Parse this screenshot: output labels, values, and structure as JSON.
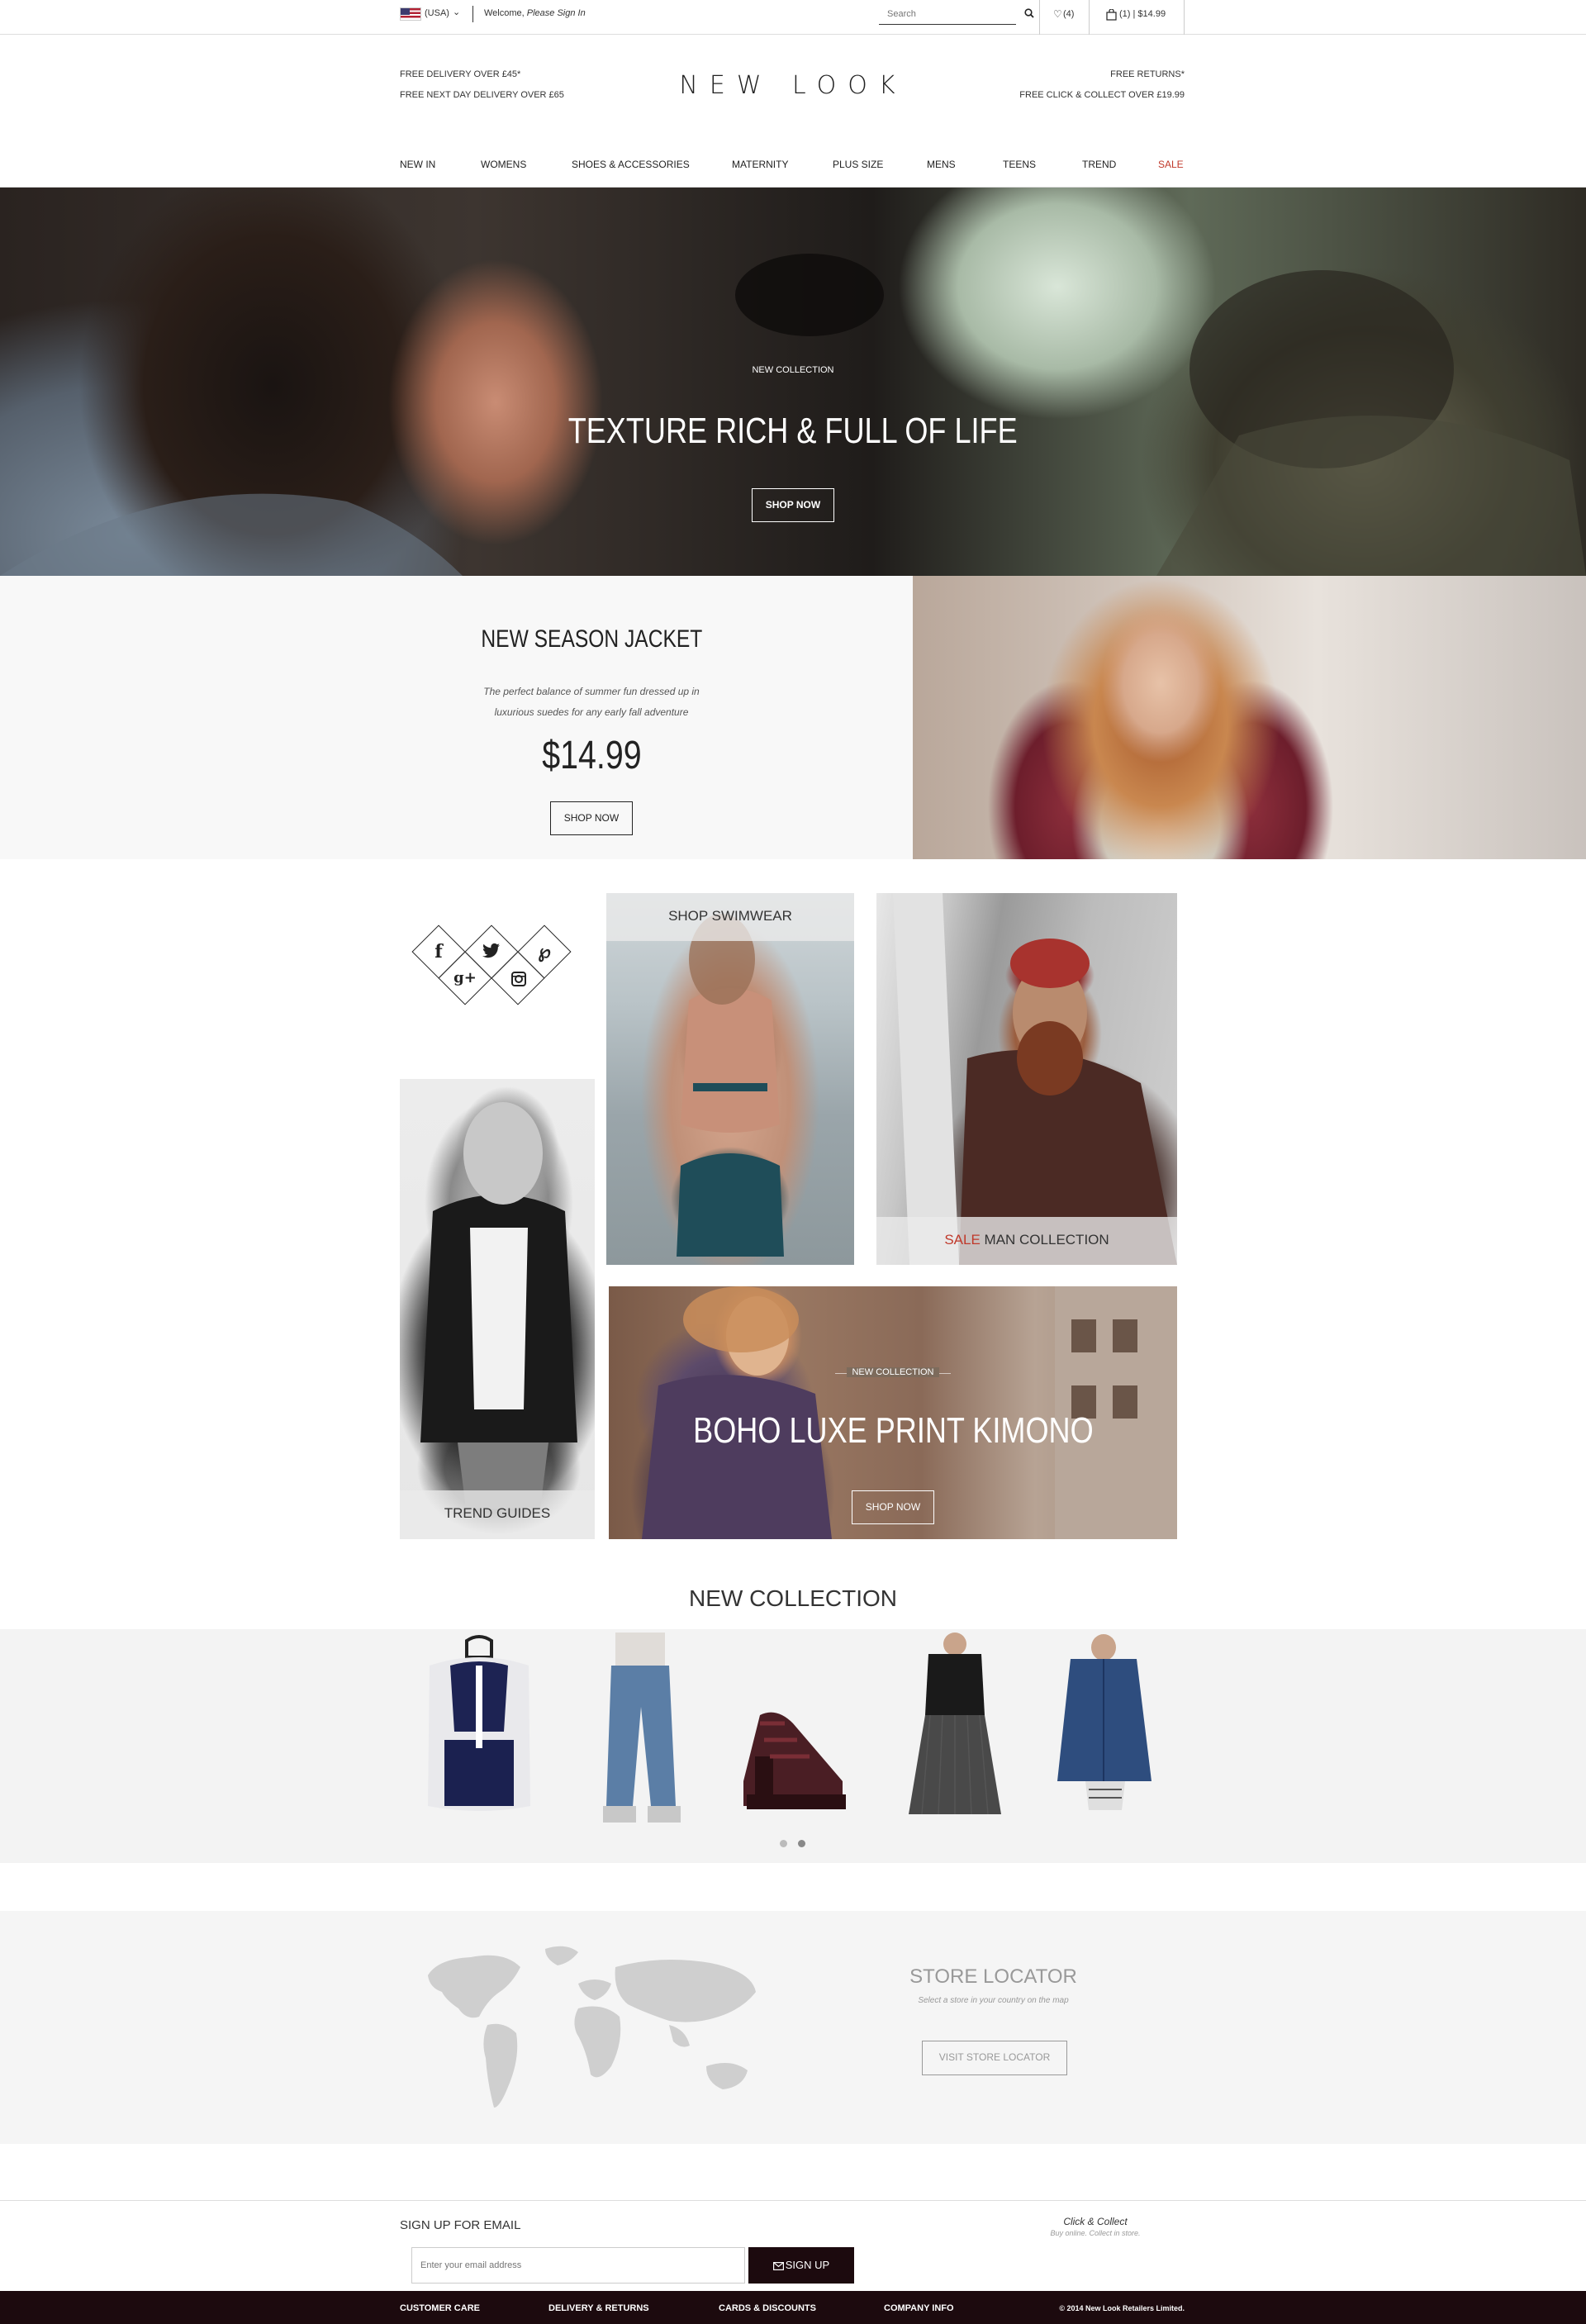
{
  "topbar": {
    "country": "(USA)",
    "welcome_prefix": "Welcome,",
    "welcome_link": "Please Sign In",
    "search_placeholder": "Search",
    "wishlist": "(4)",
    "cart": "(1) | $14.99"
  },
  "header": {
    "left_line1": "FREE DELIVERY OVER £45*",
    "left_line2": "FREE NEXT DAY DELIVERY OVER £65",
    "logo": "NEW LOOK",
    "right_line1": "FREE RETURNS*",
    "right_line2": "FREE CLICK & COLLECT OVER £19.99"
  },
  "nav": [
    {
      "label": "NEW IN"
    },
    {
      "label": "WOMENS"
    },
    {
      "label": "SHOES & ACCESSORIES"
    },
    {
      "label": "MATERNITY"
    },
    {
      "label": "PLUS SIZE"
    },
    {
      "label": "MENS"
    },
    {
      "label": "TEENS"
    },
    {
      "label": "TREND"
    },
    {
      "label": "SALE"
    }
  ],
  "hero": {
    "kicker": "NEW COLLECTION",
    "title": "TEXTURE RICH & FULL OF LIFE",
    "button": "SHOP NOW"
  },
  "jacket": {
    "title": "NEW SEASON JACKET",
    "desc_line1": "The perfect balance of summer fun dressed up in",
    "desc_line2": "luxurious suedes for any early fall adventure",
    "price": "$14.99",
    "button": "SHOP NOW"
  },
  "tiles": {
    "swimwear": "SHOP SWIMWEAR",
    "man_sale": "SALE",
    "man_label": "MAN COLLECTION",
    "trend": "TREND GUIDES",
    "kimono_kicker": "NEW COLLECTION",
    "kimono_title": "BOHO LUXE PRINT KIMONO",
    "kimono_button": "SHOP NOW"
  },
  "new_collection": {
    "title": "NEW COLLECTION",
    "products": [
      "backpack",
      "jeans",
      "heels",
      "pleated-dress",
      "denim-parka"
    ],
    "active_dot": 1
  },
  "store_locator": {
    "title": "STORE LOCATOR",
    "subtitle": "Select a store in your country on the map",
    "button": "VISIT STORE LOCATOR"
  },
  "signup": {
    "title": "SIGN UP FOR EMAIL",
    "placeholder": "Enter your email address",
    "button": "SIGN UP",
    "cc_title": "Click & Collect",
    "cc_sub": "Buy online. Collect in store."
  },
  "footer": {
    "links": [
      "CUSTOMER CARE",
      "DELIVERY & RETURNS",
      "CARDS & DISCOUNTS",
      "COMPANY INFO"
    ],
    "copyright": "© 2014 New Look Retailers Limited."
  },
  "colors": {
    "accent_sale": "#c0392b",
    "footer_bg": "#1c0a0e"
  }
}
